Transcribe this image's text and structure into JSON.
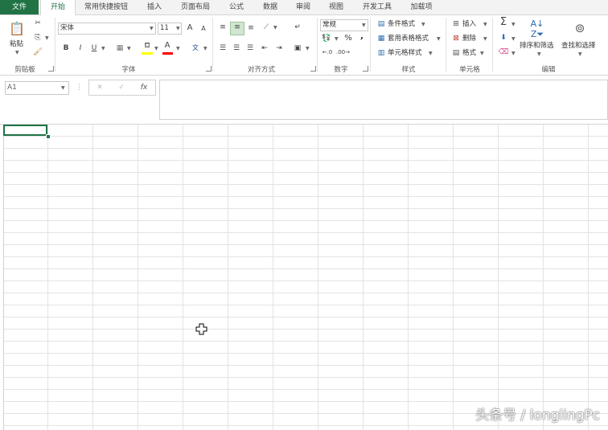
{
  "tabs": [
    "文件",
    "开始",
    "常用快捷按钮",
    "插入",
    "页面布局",
    "公式",
    "数据",
    "审阅",
    "视图",
    "开发工具",
    "加载项"
  ],
  "clipboard": {
    "paste": "粘贴",
    "group": "剪贴板"
  },
  "font": {
    "name": "宋体",
    "size": "11",
    "group": "字体",
    "grow": "A",
    "shrink": "A",
    "bold": "B",
    "italic": "I",
    "underline": "U",
    "phonetic": "文"
  },
  "alignment": {
    "group": "对齐方式"
  },
  "number": {
    "format": "常规",
    "group": "数字",
    "percent": "%",
    "comma": ","
  },
  "styles": {
    "conditional": "条件格式",
    "table": "套用表格格式",
    "cell": "单元格样式",
    "group": "样式"
  },
  "cells": {
    "insert": "插入",
    "delete": "删除",
    "format": "格式",
    "group": "单元格"
  },
  "editing": {
    "sortfilter": "排序和筛选",
    "findselect": "查找和选择",
    "group": "编辑"
  },
  "formula": {
    "namebox": "A1",
    "fx": "fx",
    "cancel": "✕",
    "enter": "✓"
  },
  "watermark": "头条号 / longlingPc",
  "colors": {
    "accent": "#217346"
  }
}
